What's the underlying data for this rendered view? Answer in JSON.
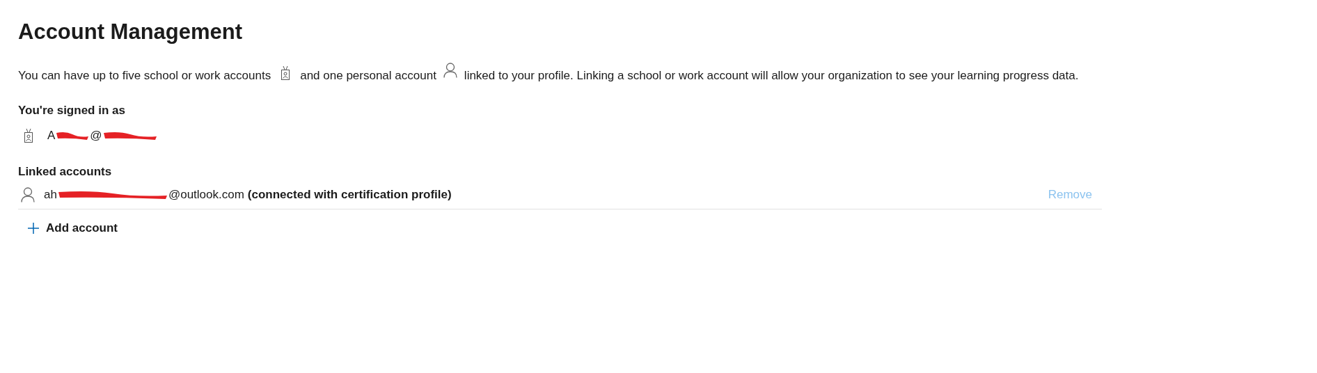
{
  "title": "Account Management",
  "intro": {
    "part_1": "You can have up to five school or work accounts",
    "part_2": "and one personal account",
    "part_3": "linked to your profile. Linking a school or work account will allow your organization to see your learning progress data."
  },
  "signed_in": {
    "heading": "You're signed in as",
    "email_start": "A",
    "email_middle": "@"
  },
  "linked": {
    "heading": "Linked accounts",
    "accounts": [
      {
        "email_start": "ah",
        "email_end": "@outlook.com",
        "note": "(connected with certification profile)",
        "remove": {
          "label": "Remove",
          "disabled": true
        }
      }
    ]
  },
  "add_account": {
    "label": "Add account"
  }
}
